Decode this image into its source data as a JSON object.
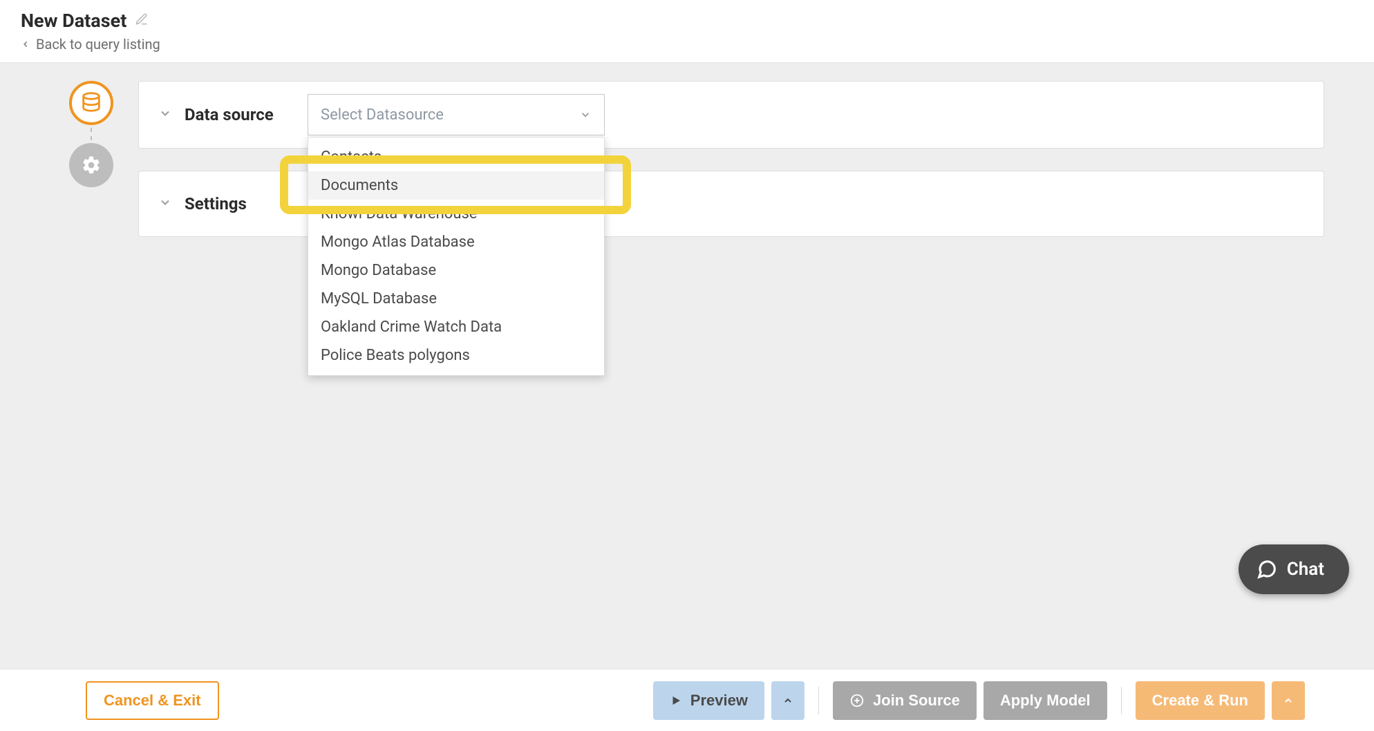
{
  "header": {
    "title": "New Dataset",
    "back_label": "Back to query listing"
  },
  "panels": {
    "datasource": {
      "label": "Data source",
      "placeholder": "Select Datasource",
      "options": [
        "Contacts",
        "Documents",
        "Knowi Data Warehouse",
        "Mongo Atlas Database",
        "Mongo Database",
        "MySQL Database",
        "Oakland Crime Watch Data",
        "Police Beats polygons"
      ],
      "highlighted_index": 1
    },
    "settings": {
      "label": "Settings"
    }
  },
  "chat": {
    "label": "Chat"
  },
  "footer": {
    "cancel": "Cancel & Exit",
    "preview": "Preview",
    "join": "Join Source",
    "apply_model": "Apply Model",
    "create_run": "Create & Run"
  }
}
